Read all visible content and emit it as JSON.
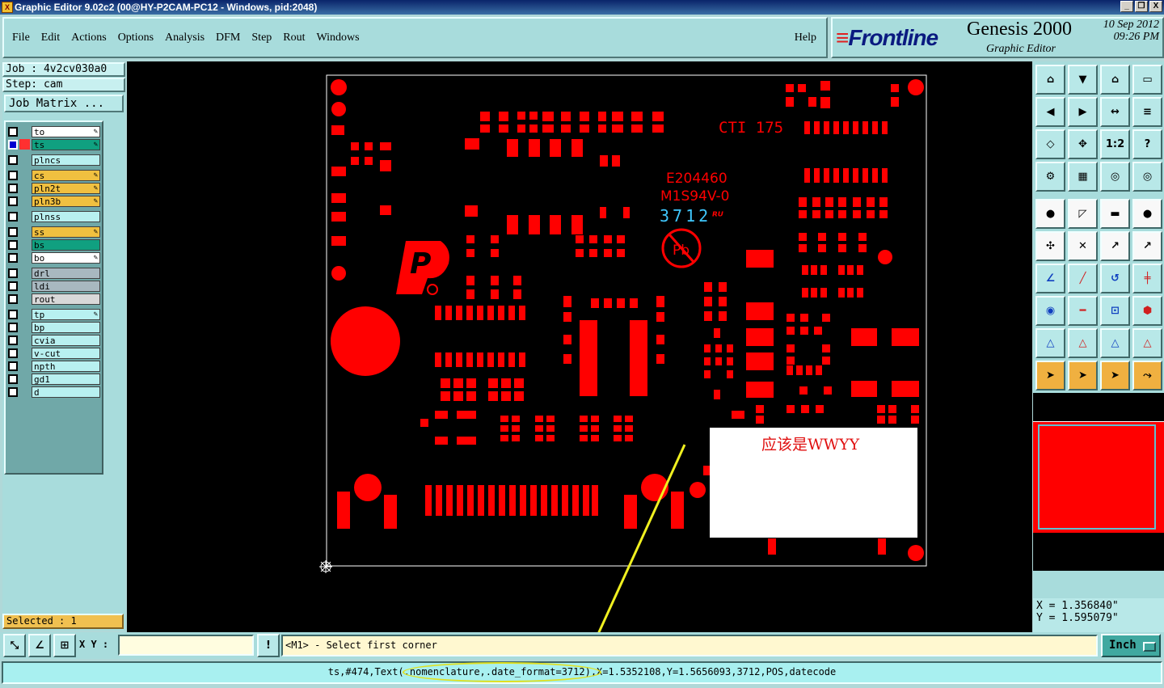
{
  "window": {
    "title": "Graphic Editor 9.02c2 (00@HY-P2CAM-PC12 - Windows, pid:2048)",
    "buttons": [
      "_",
      "❐",
      "X"
    ]
  },
  "menubar": {
    "items": [
      "File",
      "Edit",
      "Actions",
      "Options",
      "Analysis",
      "DFM",
      "Step",
      "Rout",
      "Windows"
    ],
    "help": "Help"
  },
  "brand": {
    "logo": "Frontline",
    "product": "Genesis 2000",
    "subtitle": "Graphic Editor",
    "date": "10  Sep  2012",
    "time": "09:26  PM"
  },
  "job": {
    "job_label": "Job : 4v2cv030a0",
    "step_label": "Step: cam",
    "matrix_button": "Job Matrix ..."
  },
  "layers": [
    [
      {
        "name": "to",
        "color": "#ffffff",
        "pen": true,
        "checked": false
      },
      {
        "name": "ts",
        "color": "#10a080",
        "pen": true,
        "checked": true,
        "active": true
      }
    ],
    [
      {
        "name": "plncs",
        "color": "#b8f0f0",
        "pen": false,
        "checked": false
      }
    ],
    [
      {
        "name": "cs",
        "color": "#f0c040",
        "pen": true,
        "checked": false
      },
      {
        "name": "pln2t",
        "color": "#f0c040",
        "pen": true,
        "checked": false
      },
      {
        "name": "pln3b",
        "color": "#f0c040",
        "pen": true,
        "checked": false
      }
    ],
    [
      {
        "name": "plnss",
        "color": "#b8f0f0",
        "pen": false,
        "checked": false
      }
    ],
    [
      {
        "name": "ss",
        "color": "#f0c040",
        "pen": true,
        "checked": false
      },
      {
        "name": "bs",
        "color": "#10a080",
        "pen": false,
        "checked": false
      },
      {
        "name": "bo",
        "color": "#ffffff",
        "pen": true,
        "checked": false
      }
    ],
    [
      {
        "name": "drl",
        "color": "#a8b8c0",
        "pen": false,
        "checked": false
      },
      {
        "name": "ldi",
        "color": "#a8b8c0",
        "pen": false,
        "checked": false
      },
      {
        "name": "rout",
        "color": "#d8d8d8",
        "pen": false,
        "checked": false
      }
    ],
    [
      {
        "name": "tp",
        "color": "#b8f0f0",
        "pen": true,
        "checked": false
      },
      {
        "name": "bp",
        "color": "#b8f0f0",
        "pen": false,
        "checked": false
      },
      {
        "name": "cvia",
        "color": "#b8f0f0",
        "pen": false,
        "checked": false
      },
      {
        "name": "v-cut",
        "color": "#b8f0f0",
        "pen": false,
        "checked": false
      },
      {
        "name": "npth",
        "color": "#b8f0f0",
        "pen": false,
        "checked": false
      },
      {
        "name": "gd1",
        "color": "#b8f0f0",
        "pen": false,
        "checked": false
      },
      {
        "name": "d",
        "color": "#b8f0f0",
        "pen": false,
        "checked": false
      }
    ]
  ],
  "selected": "Selected : 1",
  "board": {
    "texts": {
      "cti": "CTI 175",
      "ul": "E204460",
      "grade": "M1S94V-0",
      "datecode": "3712",
      "pb": "Pb",
      "p_logo": "P"
    },
    "note": "应该是WWYY",
    "colors": {
      "pad": "#ff0000",
      "datecode": "#40c8ff",
      "arrow": "#f0f020",
      "outline": "#ffffff"
    }
  },
  "coords": {
    "x": "X = 1.356840\"",
    "y": "Y = 1.595079\""
  },
  "bottombar": {
    "xy_label": "X Y :",
    "xy_value": "",
    "prompt": "<M1> - Select first corner",
    "units": "Inch",
    "excl": "!"
  },
  "statusline": "ts,#474,Text(.nomenclature,.date_format=3712),X=1.5352108,Y=1.5656093,3712,POS,datecode",
  "toolbar_icons": [
    "zoom-home-icon",
    "zoom-in-icon",
    "zoom-fit-icon",
    "split-view-icon",
    "pan-left-icon",
    "pan-right-icon",
    "mirror-icon",
    "flip-icon",
    "fit-icon",
    "center-icon",
    "one-to-one-icon",
    "help-query-icon",
    "ruler-icon",
    "grid-icon",
    "snap-icon",
    "snap-active-icon",
    "pad-icon",
    "draw-line-icon",
    "measure-icon",
    "circle-icon",
    "select-net-icon",
    "cross-icon",
    "connect-icon",
    "connect2-icon",
    "angle-icon",
    "line-icon",
    "arc-icon",
    "text-icon",
    "pad-add-icon",
    "edge-icon",
    "stretch-icon",
    "shape-icon",
    "triangle-icon",
    "triangle2-icon",
    "triangle3-icon",
    "triangle4-icon",
    "pointer-icon",
    "pointer-box-icon",
    "pointer-alt-icon",
    "route-icon"
  ]
}
